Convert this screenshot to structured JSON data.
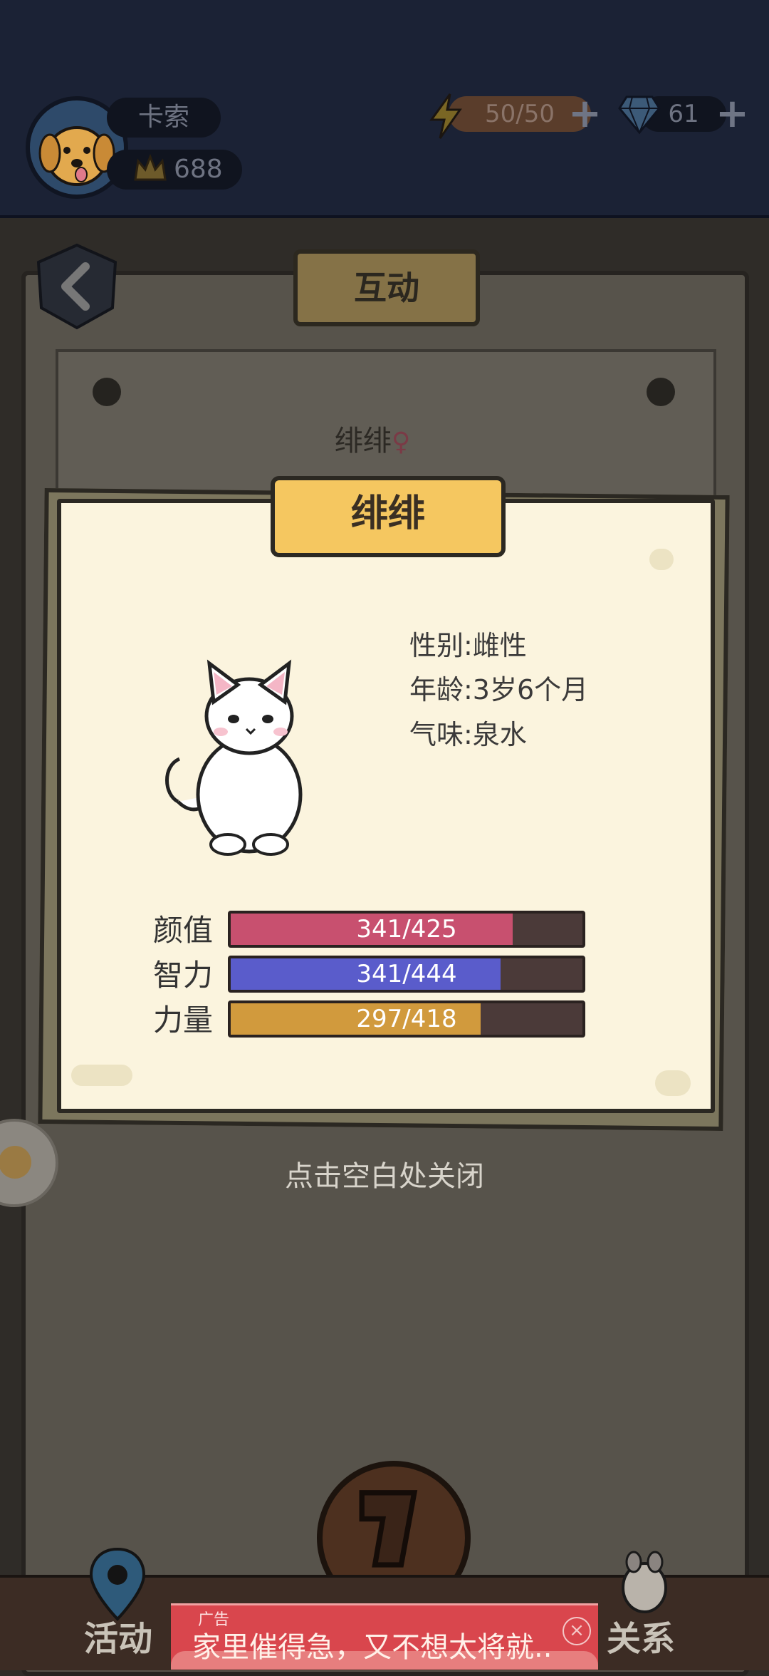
{
  "header": {
    "player_name": "卡索",
    "crown_score": "688",
    "energy": "50/50",
    "gems": "61",
    "plus": "+"
  },
  "background": {
    "banner_title": "互动",
    "cat_name": "绯绯",
    "female_symbol": "♀",
    "close_hint": "点击空白处关闭"
  },
  "card": {
    "title": "绯绯",
    "gender": "性别:雌性",
    "age": "年龄:3岁6个月",
    "scent": "气味:泉水",
    "stats": [
      {
        "label": "颜值",
        "value": "341/425",
        "fraction": 0.802,
        "color": "#c8506f"
      },
      {
        "label": "智力",
        "value": "341/444",
        "fraction": 0.768,
        "color": "#5a5ccb"
      },
      {
        "label": "力量",
        "value": "297/418",
        "fraction": 0.711,
        "color": "#d19a3d"
      }
    ]
  },
  "nav": {
    "activity": "活动",
    "relations": "关系"
  },
  "ad": {
    "tag": "广告",
    "text": "家里催得急，又不想太将就..",
    "close": "×"
  }
}
